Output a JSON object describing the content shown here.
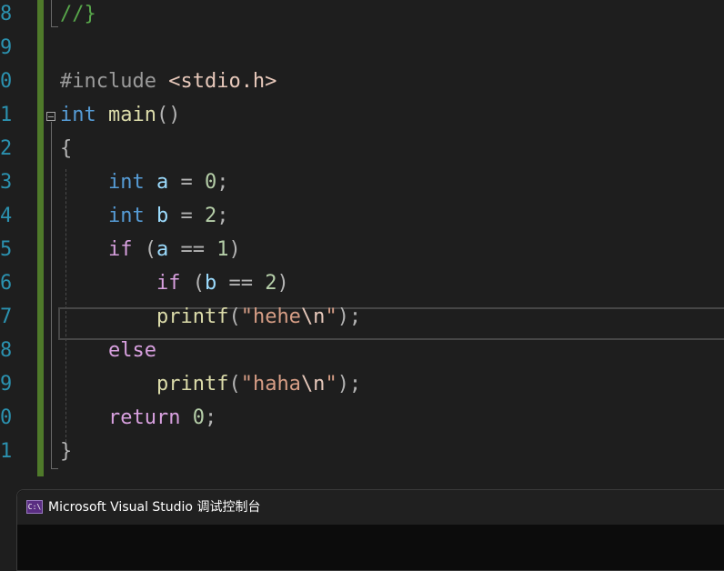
{
  "editor": {
    "line_numbers": [
      "8",
      "9",
      "0",
      "1",
      "2",
      "3",
      "4",
      "5",
      "6",
      "7",
      "8",
      "9",
      "0",
      "1"
    ],
    "lines": [
      {
        "tokens": [
          {
            "t": "//}",
            "c": "cmt"
          }
        ]
      },
      {
        "tokens": []
      },
      {
        "tokens": [
          {
            "t": "#include ",
            "c": "pre"
          },
          {
            "t": "<stdio.h>",
            "c": "inc"
          }
        ]
      },
      {
        "tokens": [
          {
            "t": "int",
            "c": "kw"
          },
          {
            "t": " ",
            "c": ""
          },
          {
            "t": "main",
            "c": "fn"
          },
          {
            "t": "()",
            "c": "punc"
          }
        ]
      },
      {
        "tokens": [
          {
            "t": "{",
            "c": "punc"
          }
        ]
      },
      {
        "tokens": [
          {
            "t": "    ",
            "c": ""
          },
          {
            "t": "int",
            "c": "kw"
          },
          {
            "t": " ",
            "c": ""
          },
          {
            "t": "a",
            "c": "var"
          },
          {
            "t": " = ",
            "c": "punc"
          },
          {
            "t": "0",
            "c": "num"
          },
          {
            "t": ";",
            "c": "punc"
          }
        ]
      },
      {
        "tokens": [
          {
            "t": "    ",
            "c": ""
          },
          {
            "t": "int",
            "c": "kw"
          },
          {
            "t": " ",
            "c": ""
          },
          {
            "t": "b",
            "c": "var"
          },
          {
            "t": " = ",
            "c": "punc"
          },
          {
            "t": "2",
            "c": "num"
          },
          {
            "t": ";",
            "c": "punc"
          }
        ]
      },
      {
        "tokens": [
          {
            "t": "    ",
            "c": ""
          },
          {
            "t": "if",
            "c": "ctl"
          },
          {
            "t": " (",
            "c": "punc"
          },
          {
            "t": "a",
            "c": "var"
          },
          {
            "t": " == ",
            "c": "punc"
          },
          {
            "t": "1",
            "c": "num"
          },
          {
            "t": ")",
            "c": "punc"
          }
        ]
      },
      {
        "tokens": [
          {
            "t": "        ",
            "c": ""
          },
          {
            "t": "if",
            "c": "ctl"
          },
          {
            "t": " (",
            "c": "punc"
          },
          {
            "t": "b",
            "c": "var"
          },
          {
            "t": " == ",
            "c": "punc"
          },
          {
            "t": "2",
            "c": "num"
          },
          {
            "t": ")",
            "c": "punc"
          }
        ]
      },
      {
        "tokens": [
          {
            "t": "        ",
            "c": ""
          },
          {
            "t": "printf",
            "c": "fn"
          },
          {
            "t": "(",
            "c": "punc"
          },
          {
            "t": "\"hehe",
            "c": "str"
          },
          {
            "t": "\\n",
            "c": "esc"
          },
          {
            "t": "\"",
            "c": "str"
          },
          {
            "t": ");",
            "c": "punc"
          }
        ]
      },
      {
        "tokens": [
          {
            "t": "    ",
            "c": ""
          },
          {
            "t": "else",
            "c": "ctl"
          }
        ]
      },
      {
        "tokens": [
          {
            "t": "        ",
            "c": ""
          },
          {
            "t": "printf",
            "c": "fn"
          },
          {
            "t": "(",
            "c": "punc"
          },
          {
            "t": "\"haha",
            "c": "str"
          },
          {
            "t": "\\n",
            "c": "esc"
          },
          {
            "t": "\"",
            "c": "str"
          },
          {
            "t": ");",
            "c": "punc"
          }
        ]
      },
      {
        "tokens": [
          {
            "t": "    ",
            "c": ""
          },
          {
            "t": "return",
            "c": "ctl"
          },
          {
            "t": " ",
            "c": ""
          },
          {
            "t": "0",
            "c": "num"
          },
          {
            "t": ";",
            "c": "punc"
          }
        ]
      },
      {
        "tokens": [
          {
            "t": "}",
            "c": "punc"
          }
        ]
      }
    ],
    "collapse_icon": "minus-box-icon"
  },
  "console": {
    "title": "Microsoft Visual Studio 调试控制台",
    "icon_label": "C:\\",
    "icon": "console-icon"
  },
  "colors": {
    "keyword": "#569cd6",
    "control": "#d8a0df",
    "function": "#dcdcaa",
    "variable": "#9cdcfe",
    "number": "#b5cea8",
    "string": "#d69d85",
    "comment": "#57a64a",
    "line_number": "#2b91af",
    "change_bar": "#4f7a2a"
  }
}
